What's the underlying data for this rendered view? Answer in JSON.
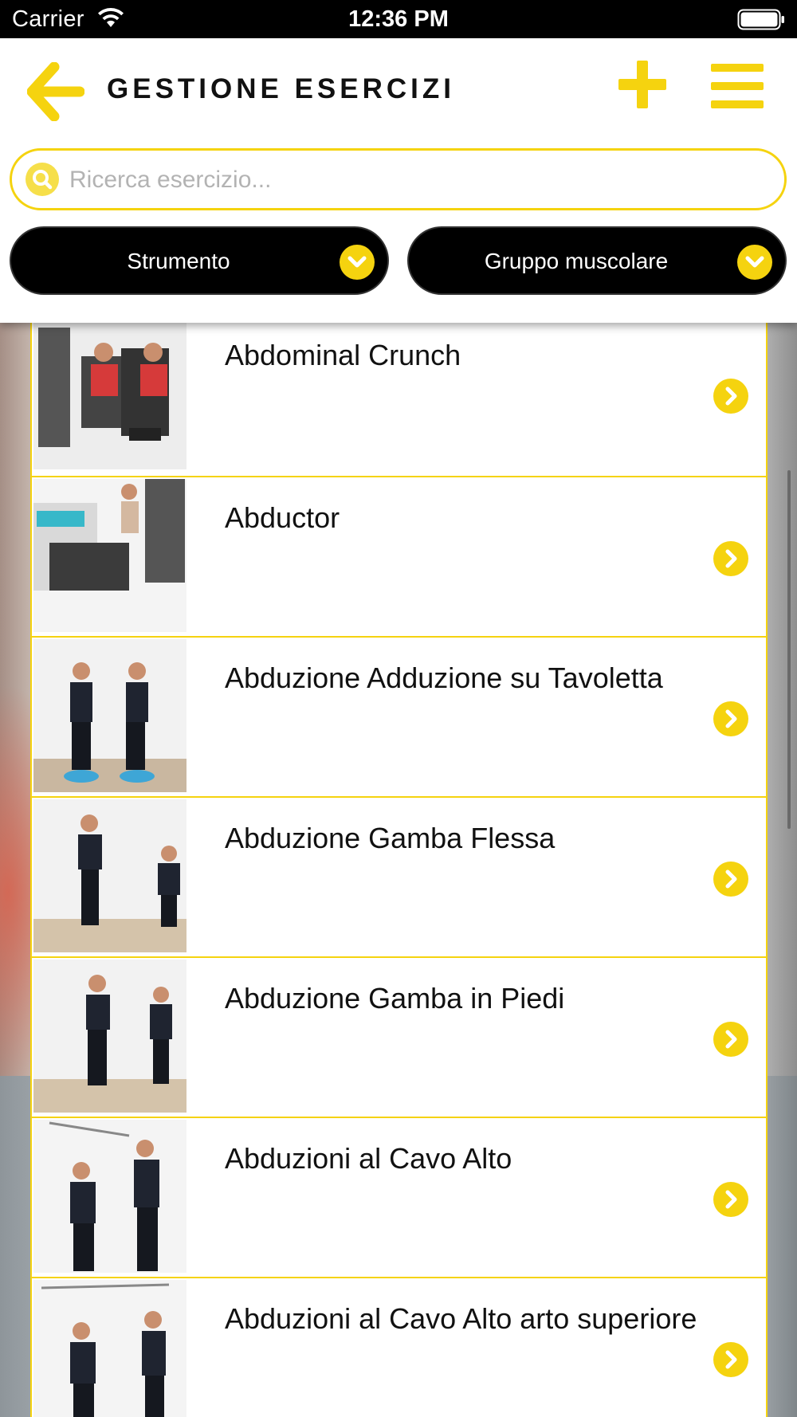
{
  "status_bar": {
    "carrier": "Carrier",
    "time": "12:36 PM"
  },
  "header": {
    "title": "GESTIONE ESERCIZI",
    "back_icon": "arrow-left-icon",
    "add_icon": "plus-icon",
    "menu_icon": "hamburger-icon"
  },
  "search": {
    "placeholder": "Ricerca esercizio...",
    "value": ""
  },
  "filters": {
    "strumento": "Strumento",
    "gruppo_muscolare": "Gruppo muscolare"
  },
  "colors": {
    "accent": "#f5d30f",
    "filter_bg": "#000000",
    "text": "#111111"
  },
  "exercises": [
    {
      "title": "Abdominal Crunch"
    },
    {
      "title": "Abductor"
    },
    {
      "title": "Abduzione Adduzione su Tavoletta"
    },
    {
      "title": "Abduzione Gamba Flessa"
    },
    {
      "title": "Abduzione Gamba in Piedi"
    },
    {
      "title": "Abduzioni al Cavo Alto"
    },
    {
      "title": "Abduzioni al Cavo Alto arto superiore"
    }
  ]
}
